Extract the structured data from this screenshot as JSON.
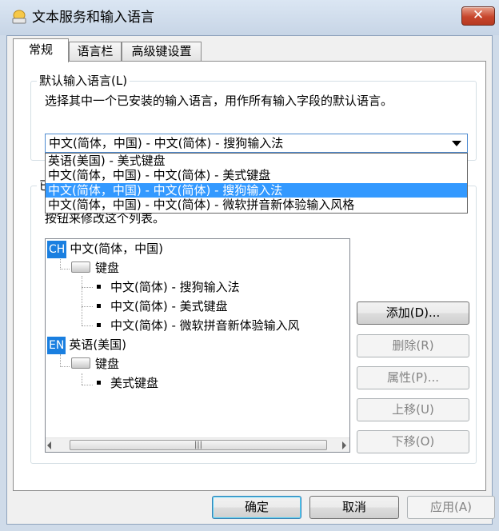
{
  "window": {
    "title": "文本服务和输入语言",
    "close_glyph": "✕"
  },
  "tabs": [
    "常规",
    "语言栏",
    "高级键设置"
  ],
  "default_group": {
    "label": "默认输入语言(L)",
    "description": "选择其中一个已安装的输入语言，用作所有输入字段的默认语言。",
    "combo_value": "中文(简体，中国) - 中文(简体) - 搜狗输入法",
    "dropdown_options": [
      "英语(美国) - 美式键盘",
      "中文(简体，中国) - 中文(简体) - 美式键盘",
      "中文(简体，中国) - 中文(简体) - 搜狗输入法",
      "中文(简体，中国) - 中文(简体) - 微软拼音新体验输入风格"
    ],
    "selected_index": 2
  },
  "installed_group": {
    "label_partial": "已",
    "description": "按钮来修改这个列表。"
  },
  "tree": {
    "languages": [
      {
        "badge": "CH",
        "name": "中文(简体，中国)",
        "category": "键盘",
        "items": [
          "中文(简体) - 搜狗输入法",
          "中文(简体) - 美式键盘",
          "中文(简体) - 微软拼音新体验输入风"
        ]
      },
      {
        "badge": "EN",
        "name": "英语(美国)",
        "category": "键盘",
        "items": [
          "美式键盘"
        ]
      }
    ],
    "scroll_thumb_glyph": "|||"
  },
  "buttons": {
    "add": "添加(D)...",
    "remove": "删除(R)",
    "properties": "属性(P)...",
    "move_up": "上移(U)",
    "move_down": "下移(O)",
    "ok": "确定",
    "cancel": "取消",
    "apply": "应用(A)"
  },
  "colors": {
    "selection": "#3399ff",
    "badge": "#1a7fe0",
    "close": "#c7462c"
  }
}
